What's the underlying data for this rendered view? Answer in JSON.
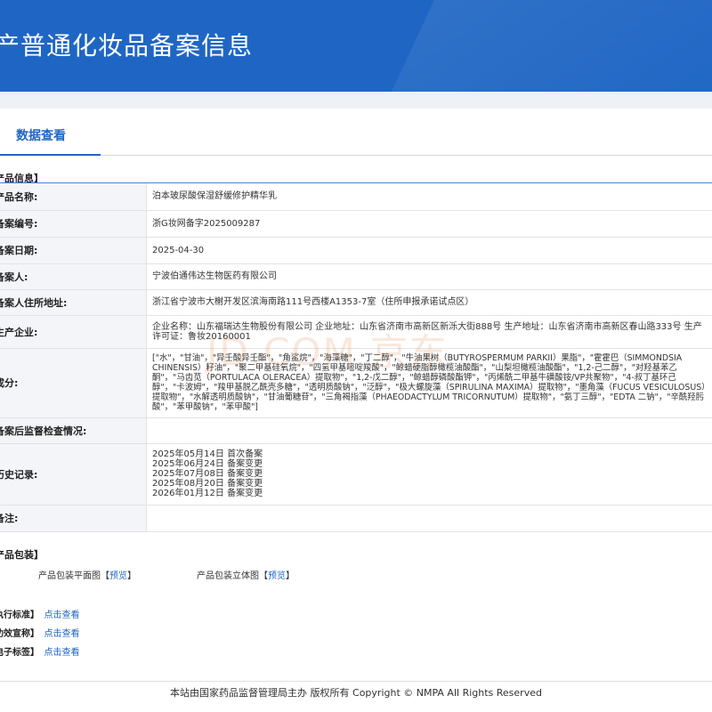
{
  "header": {
    "title": "产普通化妆品备案信息"
  },
  "tabs": [
    {
      "label": "数据查看"
    }
  ],
  "sections": {
    "product_info": "产品信息】",
    "packaging": "产品包装】"
  },
  "fields": [
    {
      "label": "产品名称:",
      "value": "泊本玻尿酸保湿舒缓修护精华乳"
    },
    {
      "label": "备案编号:",
      "value": "浙G妆网备字2025009287"
    },
    {
      "label": "备案日期:",
      "value": "2025-04-30"
    },
    {
      "label": "备案人:",
      "value": "宁波伯通伟达生物医药有限公司"
    },
    {
      "label": "备案人住所地址:",
      "value": "浙江省宁波市大榭开发区滨海南路111号西楼A1353-7室（住所申报承诺试点区）"
    },
    {
      "label": "生产企业:",
      "value": "企业名称：山东福瑞达生物股份有限公司 企业地址：山东省济南市高新区新泺大街888号 生产地址：山东省济南市高新区春山路333号 生产许可证：鲁妆20160001"
    },
    {
      "label": "成分:",
      "value": "[\"水\"，\"甘油\"，\"异壬酸异壬酯\"，\"角鲨烷\"，\"海藻糖\"，\"丁二醇\"，\"牛油果树（BUTYROSPERMUM PARKII）果脂\"，\"霍霍巴（SIMMONDSIA CHINENSIS）籽油\"，\"聚二甲基硅氧烷\"，\"四氢甲基嘧啶羧酸\"，\"鲸蜡硬脂醇橄榄油酸酯\"，\"山梨坦橄榄油酸酯\"，\"1,2-己二醇\"，\"对羟基苯乙酮\"，\"马齿苋（PORTULACA OLERACEA）提取物\"，\"1,2-戊二醇\"，\"鲸蜡醇磷酸酯钾\"，\"丙烯酰二甲基牛磺酸铵/VP共聚物\"，\"4-叔丁基环己醇\"，\"卡波姆\"，\"羧甲基脱乙酰壳多糖\"，\"透明质酸钠\"，\"泛醇\"，\"极大螺旋藻（SPIRULINA MAXIMA）提取物\"，\"墨角藻（FUCUS VESICULOSUS）提取物\"，\"水解透明质酸钠\"，\"甘油葡糖苷\"，\"三角褐指藻（PHAEODACTYLUM TRICORNUTUM）提取物\"，\"氨丁三醇\"，\"EDTA 二钠\"，\"辛酰羟肟酸\"，\"苯甲酸钠\"，\"苯甲酸\"]"
    },
    {
      "label": "备案后监督检查情况:",
      "value": ""
    },
    {
      "label": "历史记录:",
      "value": ""
    },
    {
      "label": "备注:",
      "value": ""
    }
  ],
  "history": [
    "2025年05月14日 首次备案",
    "2025年06月24日 备案变更",
    "2025年07月08日 备案变更",
    "2025年08月20日 备案变更",
    "2026年01月12日 备案变更"
  ],
  "packaging": {
    "flat": {
      "label": "产品包装平面图",
      "link": "预览"
    },
    "solid": {
      "label": "产品包装立体图",
      "link": "预览"
    }
  },
  "extra_rows": [
    {
      "label": "执行标准】",
      "link": "点击查看"
    },
    {
      "label": "功效宣称】",
      "link": "点击查看"
    },
    {
      "label": "电子标签】",
      "link": "点击查看"
    }
  ],
  "footer": "本站由国家药品监督管理局主办 版权所有 Copyright © NMPA All Rights Reserved",
  "watermark": "JD.COM 京东",
  "colors": {
    "brand_blue": "#1f66c4",
    "label_bg": "#f3f5f8"
  }
}
